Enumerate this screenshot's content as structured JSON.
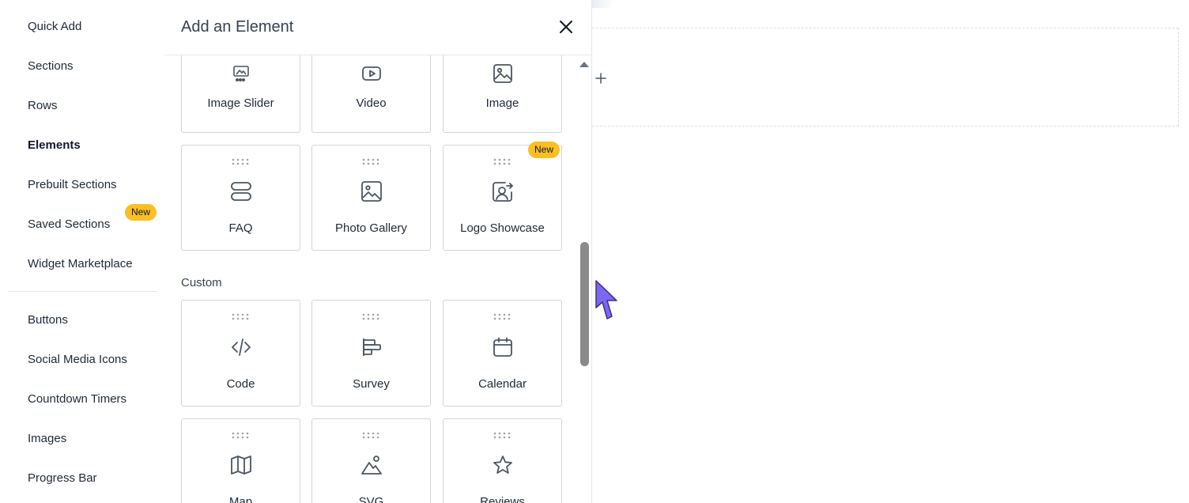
{
  "sidebar": {
    "items": [
      {
        "label": "Quick Add"
      },
      {
        "label": "Sections"
      },
      {
        "label": "Rows"
      },
      {
        "label": "Elements"
      },
      {
        "label": "Prebuilt Sections"
      },
      {
        "label": "Saved Sections",
        "badge": "New"
      },
      {
        "label": "Widget Marketplace"
      },
      {
        "label": "Buttons"
      },
      {
        "label": "Social Media Icons"
      },
      {
        "label": "Countdown Timers"
      },
      {
        "label": "Images"
      },
      {
        "label": "Progress Bar"
      }
    ],
    "active": "Elements"
  },
  "panel": {
    "title": "Add an Element",
    "close_icon": "close-icon",
    "custom_label": "Custom",
    "media_cards": [
      {
        "label": "Image Slider",
        "icon": "image-slider-icon"
      },
      {
        "label": "Video",
        "icon": "video-icon"
      },
      {
        "label": "Image",
        "icon": "image-icon"
      },
      {
        "label": "FAQ",
        "icon": "faq-icon"
      },
      {
        "label": "Photo Gallery",
        "icon": "photo-gallery-icon"
      },
      {
        "label": "Logo Showcase",
        "icon": "logo-showcase-icon",
        "badge": "New"
      }
    ],
    "custom_cards": [
      {
        "label": "Code",
        "icon": "code-icon"
      },
      {
        "label": "Survey",
        "icon": "survey-icon"
      },
      {
        "label": "Calendar",
        "icon": "calendar-icon"
      },
      {
        "label": "Map",
        "icon": "map-icon"
      },
      {
        "label": "SVG",
        "icon": "svg-icon"
      },
      {
        "label": "Reviews",
        "icon": "star-icon"
      }
    ]
  },
  "canvas": {
    "add_icon": "plus-icon"
  },
  "colors": {
    "badge": "#fbbf24",
    "cursor": "#7b68ee",
    "icon": "#4b5563"
  }
}
